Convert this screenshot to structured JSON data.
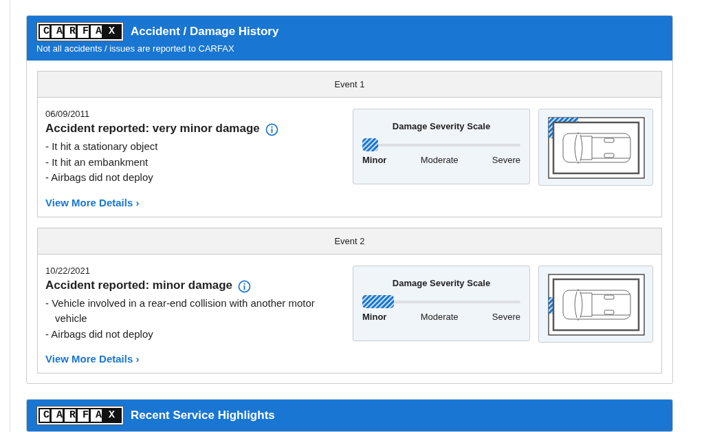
{
  "sections": [
    {
      "logo": "CARFAX",
      "title": "Accident / Damage History",
      "subtitle": "Not all accidents / issues are reported to CARFAX",
      "events": [
        {
          "header": "Event 1",
          "date": "06/09/2011",
          "title": "Accident reported: very minor damage",
          "details": [
            "- It hit a stationary object",
            "- It hit an embankment",
            "- Airbags did not deploy"
          ],
          "link": "View More Details",
          "link_icon": "›",
          "scale_title": "Damage Severity Scale",
          "scale_labels": [
            "Minor",
            "Moderate",
            "Severe"
          ],
          "level": 0.1,
          "kind": "corner"
        },
        {
          "header": "Event 2",
          "date": "10/22/2021",
          "title": "Accident reported: minor damage",
          "details": [
            "- Vehicle involved in a rear-end collision with another motor vehicle",
            "- Airbags did not deploy"
          ],
          "link": "View More Details",
          "link_icon": "›",
          "scale_title": "Damage Severity Scale",
          "scale_labels": [
            "Minor",
            "Moderate",
            "Severe"
          ],
          "level": 0.2,
          "kind": "front"
        }
      ]
    },
    {
      "logo": "CARFAX",
      "title": "Recent Service Highlights"
    }
  ]
}
